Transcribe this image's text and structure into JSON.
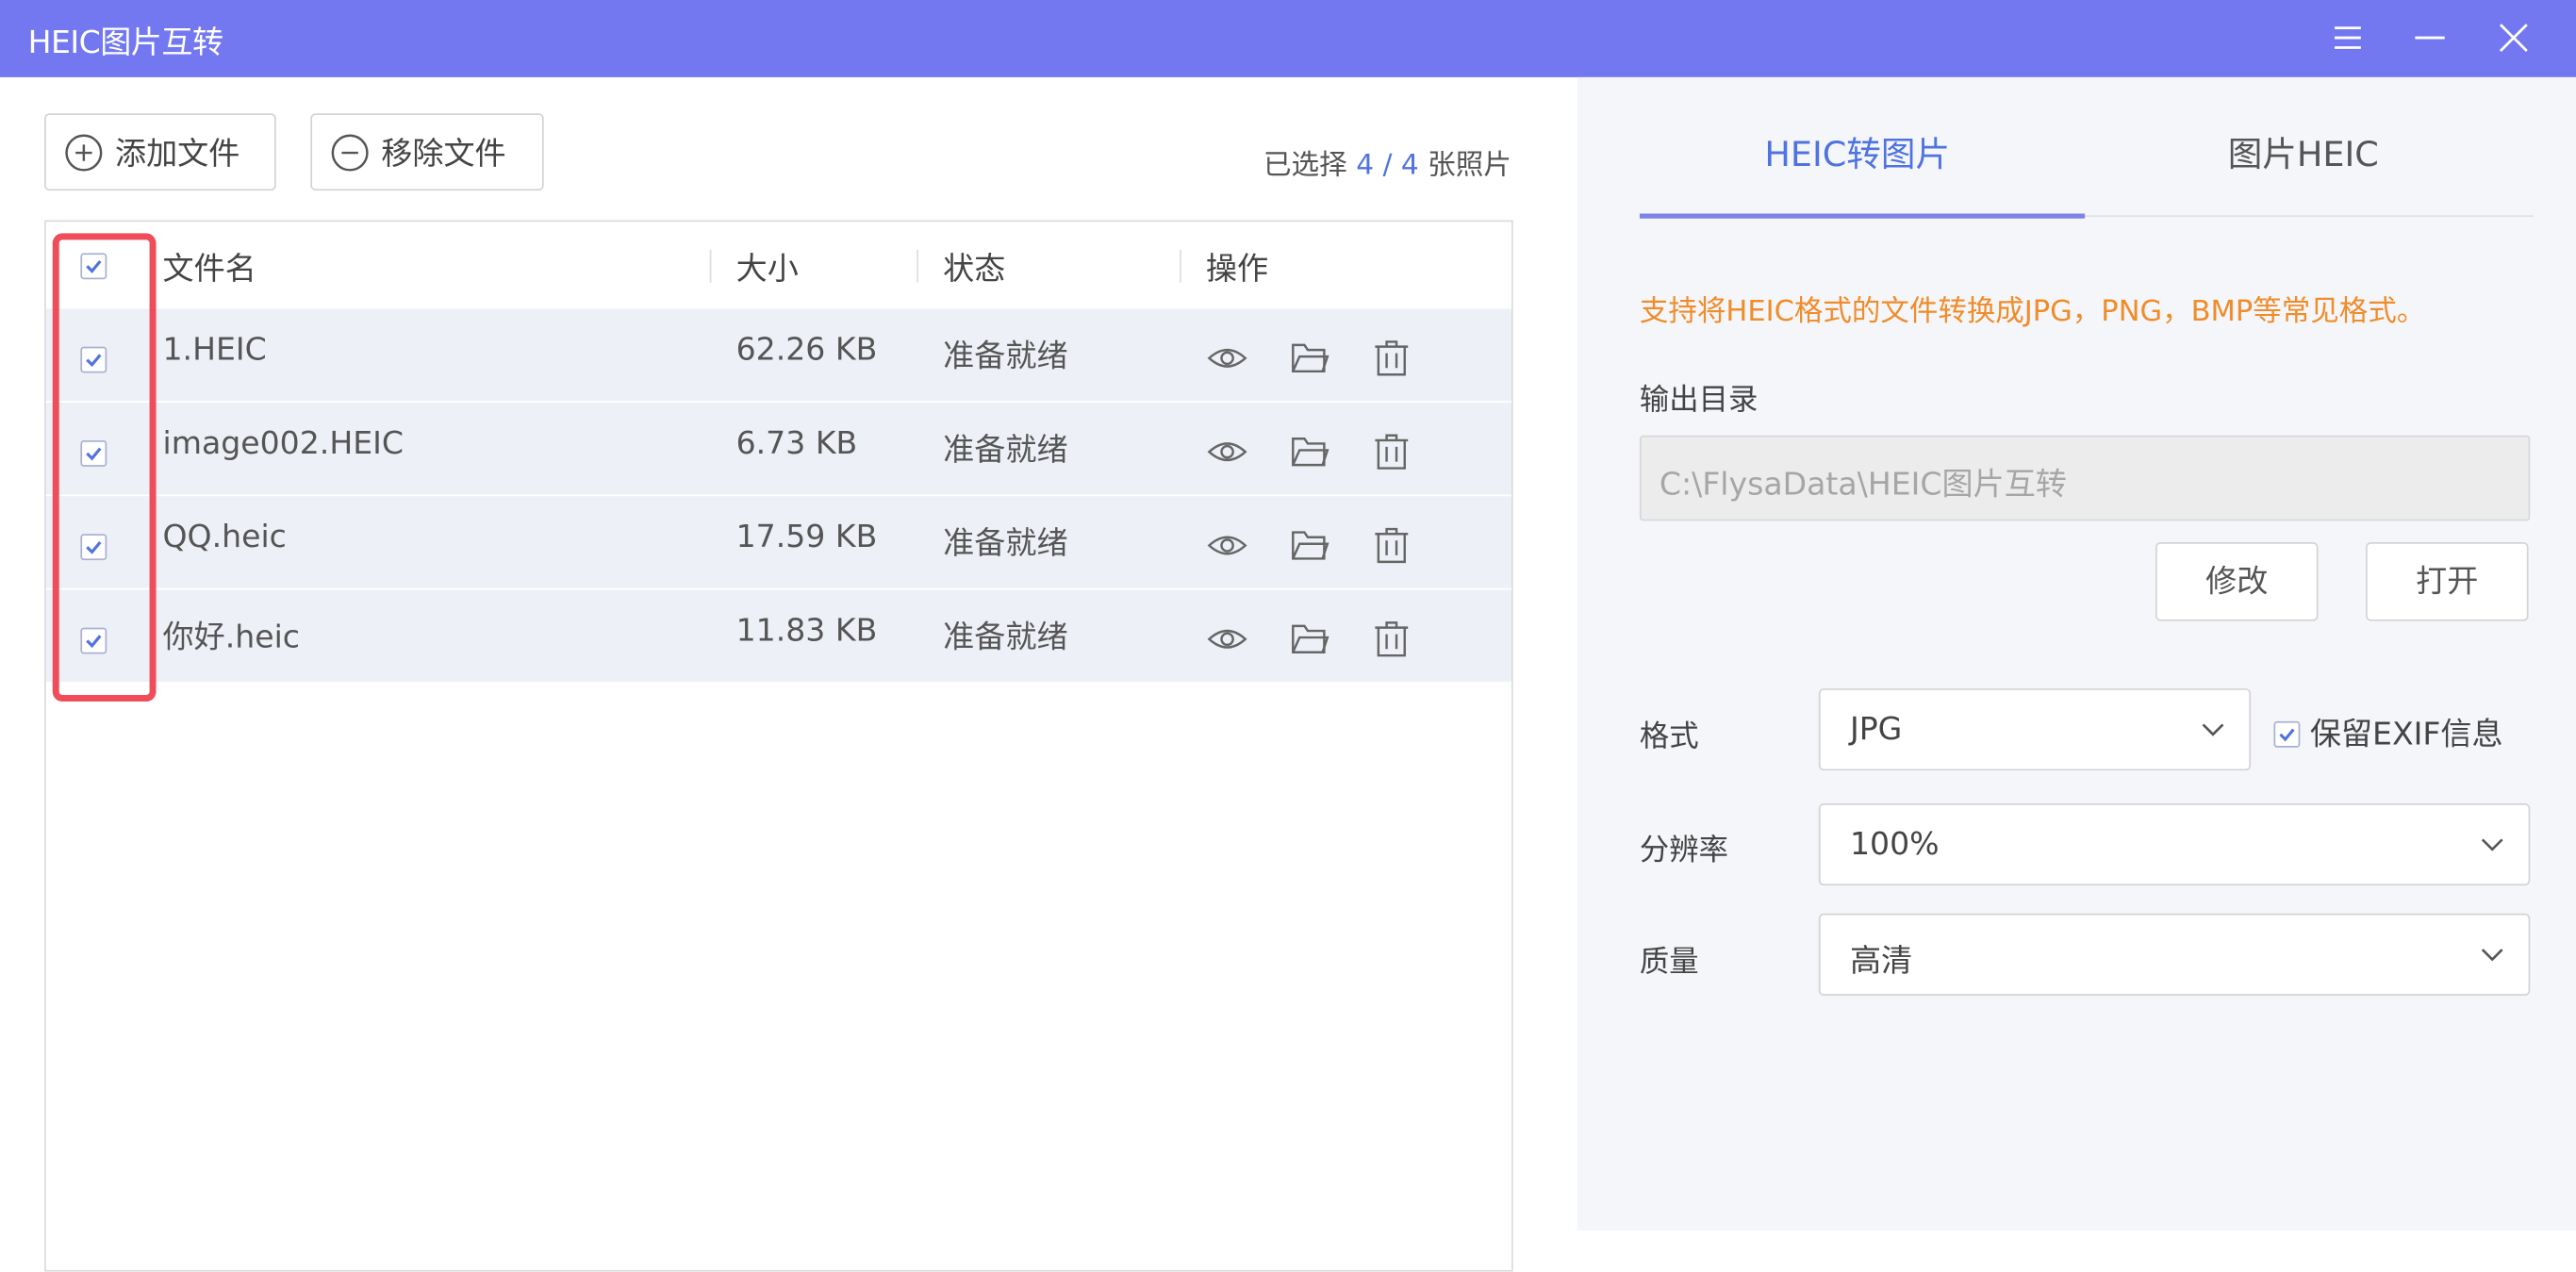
{
  "window": {
    "title": "HEIC图片互转"
  },
  "toolbar": {
    "add_label": "添加文件",
    "remove_label": "移除文件",
    "selected_prefix": "已选择",
    "selected_count": "4 / 4",
    "selected_suffix": "张照片"
  },
  "table": {
    "columns": [
      "文件名",
      "大小",
      "状态",
      "操作"
    ],
    "rows": [
      {
        "name": "1.HEIC",
        "size": "62.26 KB",
        "status": "准备就绪",
        "checked": true
      },
      {
        "name": "image002.HEIC",
        "size": "6.73 KB",
        "status": "准备就绪",
        "checked": true
      },
      {
        "name": "QQ.heic",
        "size": "17.59 KB",
        "status": "准备就绪",
        "checked": true
      },
      {
        "name": "你好.heic",
        "size": "11.83 KB",
        "status": "准备就绪",
        "checked": true
      }
    ],
    "row_icons": [
      "eye-icon",
      "folder-icon",
      "trash-icon"
    ]
  },
  "settings": {
    "tabs": [
      "HEIC转图片",
      "图片HEIC"
    ],
    "active_tab": 0,
    "notice": "支持将HEIC格式的文件转换成JPG，PNG，BMP等常见格式。",
    "output_label": "输出目录",
    "output_path": "C:\\FlysaData\\HEIC图片互转",
    "modify_label": "修改",
    "open_label": "打开",
    "format_label": "格式",
    "format_value": "JPG",
    "exif_label": "保留EXIF信息",
    "exif_checked": true,
    "resolution_label": "分辨率",
    "resolution_value": "100%",
    "quality_label": "质量",
    "quality_value": "高清"
  },
  "colors": {
    "titlebar": "#7378f0",
    "accent": "#4f73e0",
    "notice": "#f08c2a",
    "highlight": "#f04d5a"
  }
}
